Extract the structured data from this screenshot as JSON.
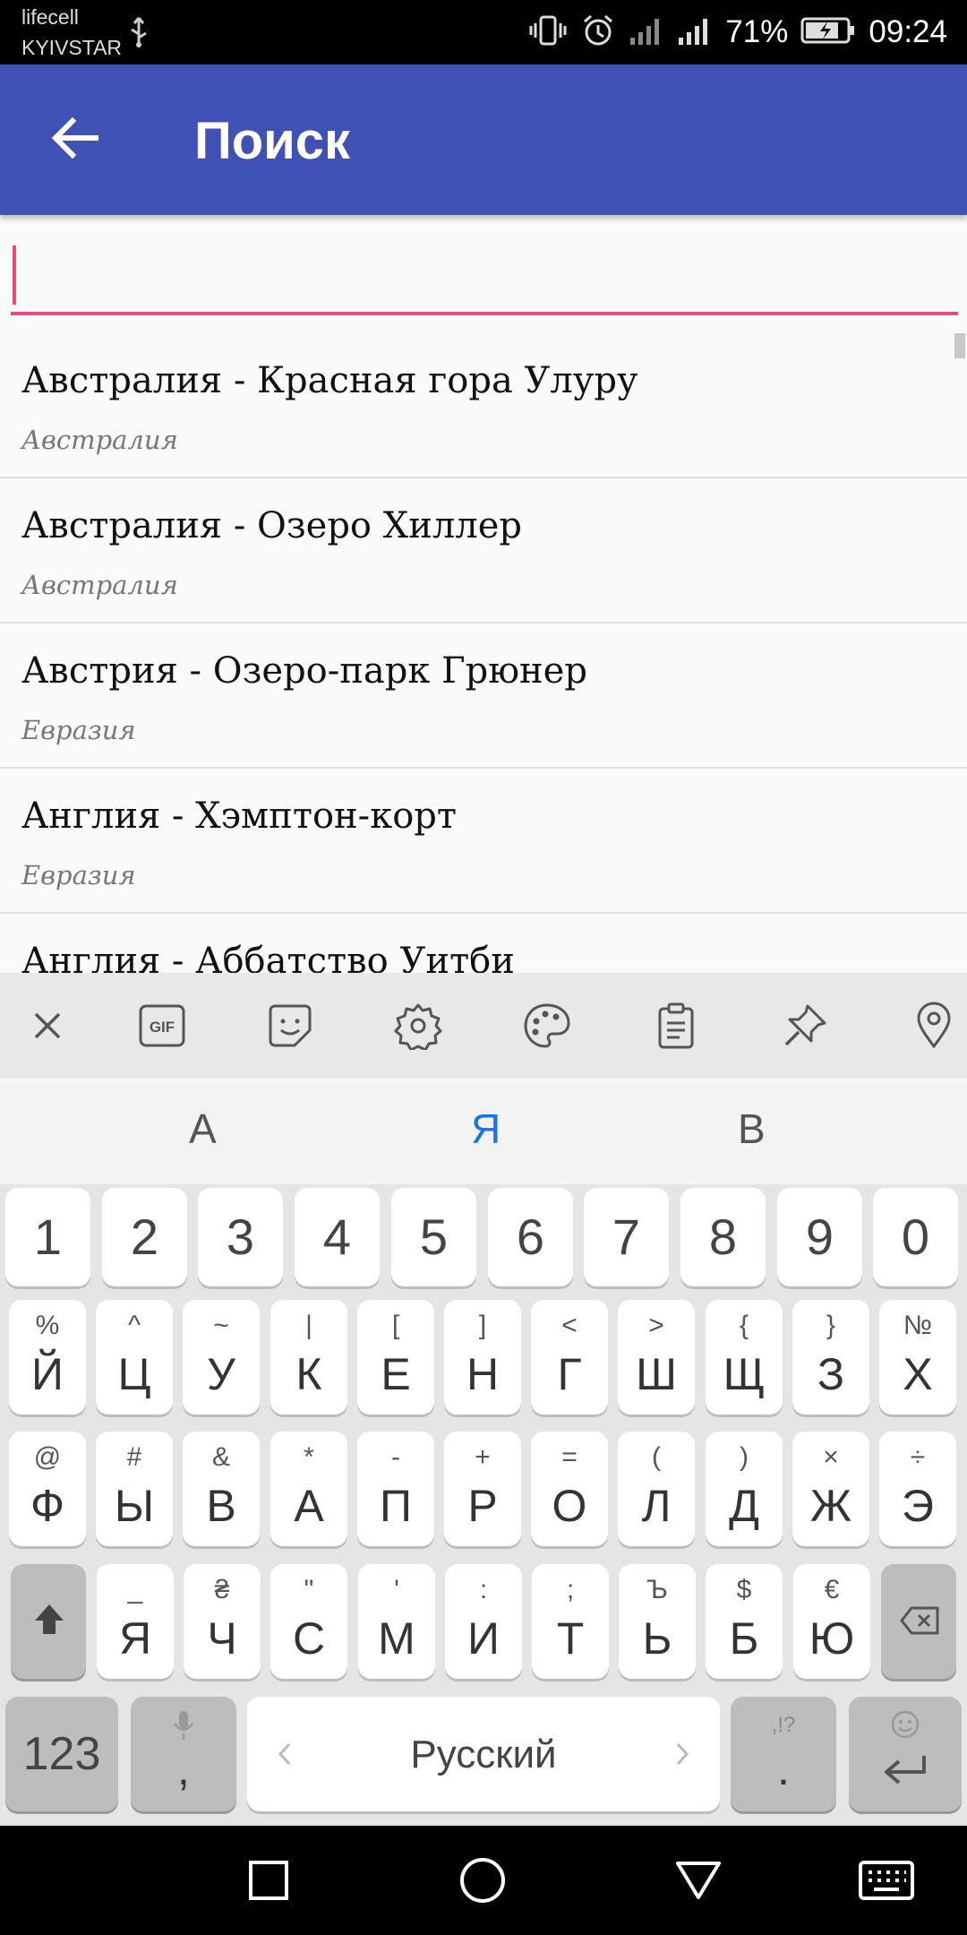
{
  "status_bar": {
    "carrier_1": "lifecell",
    "carrier_2": "KYIVSTAR",
    "battery_percent": "71%",
    "time": "09:24",
    "icons": [
      "usb-icon",
      "vibrate-icon",
      "alarm-icon",
      "signal-icon",
      "signal-icon",
      "battery-charging-icon"
    ]
  },
  "app_bar": {
    "title": "Поиск",
    "back_icon": "arrow-back-icon",
    "color": "#3f51b5"
  },
  "search": {
    "value": "",
    "accent_color": "#e94a83"
  },
  "results": [
    {
      "title": "Австралия - Красная гора Улуру",
      "region": "Австралия"
    },
    {
      "title": "Австралия - Озеро Хиллер",
      "region": "Австралия"
    },
    {
      "title": "Австрия - Озеро-парк Грюнер",
      "region": "Евразия"
    },
    {
      "title": "Англия - Хэмптон-корт",
      "region": "Евразия"
    },
    {
      "title": "Англия - Аббатство Уитби",
      "region": ""
    }
  ],
  "keyboard": {
    "toolbar_icons": [
      "close-icon",
      "gif-icon",
      "sticker-icon",
      "settings-icon",
      "palette-icon",
      "clipboard-icon",
      "pin-icon",
      "location-icon"
    ],
    "gif_label": "GIF",
    "suggestions": [
      "А",
      "Я",
      "В"
    ],
    "number_row": [
      "1",
      "2",
      "3",
      "4",
      "5",
      "6",
      "7",
      "8",
      "9",
      "0"
    ],
    "row1": [
      {
        "main": "Й",
        "sec": "%"
      },
      {
        "main": "Ц",
        "sec": "^"
      },
      {
        "main": "У",
        "sec": "~"
      },
      {
        "main": "К",
        "sec": "|"
      },
      {
        "main": "Е",
        "sec": "["
      },
      {
        "main": "Н",
        "sec": "]"
      },
      {
        "main": "Г",
        "sec": "<"
      },
      {
        "main": "Ш",
        "sec": ">"
      },
      {
        "main": "Щ",
        "sec": "{"
      },
      {
        "main": "З",
        "sec": "}"
      },
      {
        "main": "Х",
        "sec": "№"
      }
    ],
    "row2": [
      {
        "main": "Ф",
        "sec": "@"
      },
      {
        "main": "Ы",
        "sec": "#"
      },
      {
        "main": "В",
        "sec": "&"
      },
      {
        "main": "А",
        "sec": "*"
      },
      {
        "main": "П",
        "sec": "-"
      },
      {
        "main": "Р",
        "sec": "+"
      },
      {
        "main": "О",
        "sec": "="
      },
      {
        "main": "Л",
        "sec": "("
      },
      {
        "main": "Д",
        "sec": ")"
      },
      {
        "main": "Ж",
        "sec": "×"
      },
      {
        "main": "Э",
        "sec": "÷"
      }
    ],
    "row3": [
      {
        "main": "Я",
        "sec": "_"
      },
      {
        "main": "Ч",
        "sec": "₴"
      },
      {
        "main": "С",
        "sec": "\""
      },
      {
        "main": "М",
        "sec": "'"
      },
      {
        "main": "И",
        "sec": ":"
      },
      {
        "main": "Т",
        "sec": ";"
      },
      {
        "main": "Ь",
        "sec": "Ъ"
      },
      {
        "main": "Б",
        "sec": "$"
      },
      {
        "main": "Ю",
        "sec": "€"
      }
    ],
    "symbols_key": "123",
    "comma_key": ",",
    "space_label": "Русский",
    "period_key": ".",
    "period_sec": ",!?"
  },
  "nav_bar": {
    "icons": [
      "recents-icon",
      "home-icon",
      "back-icon",
      "keyboard-icon"
    ]
  }
}
